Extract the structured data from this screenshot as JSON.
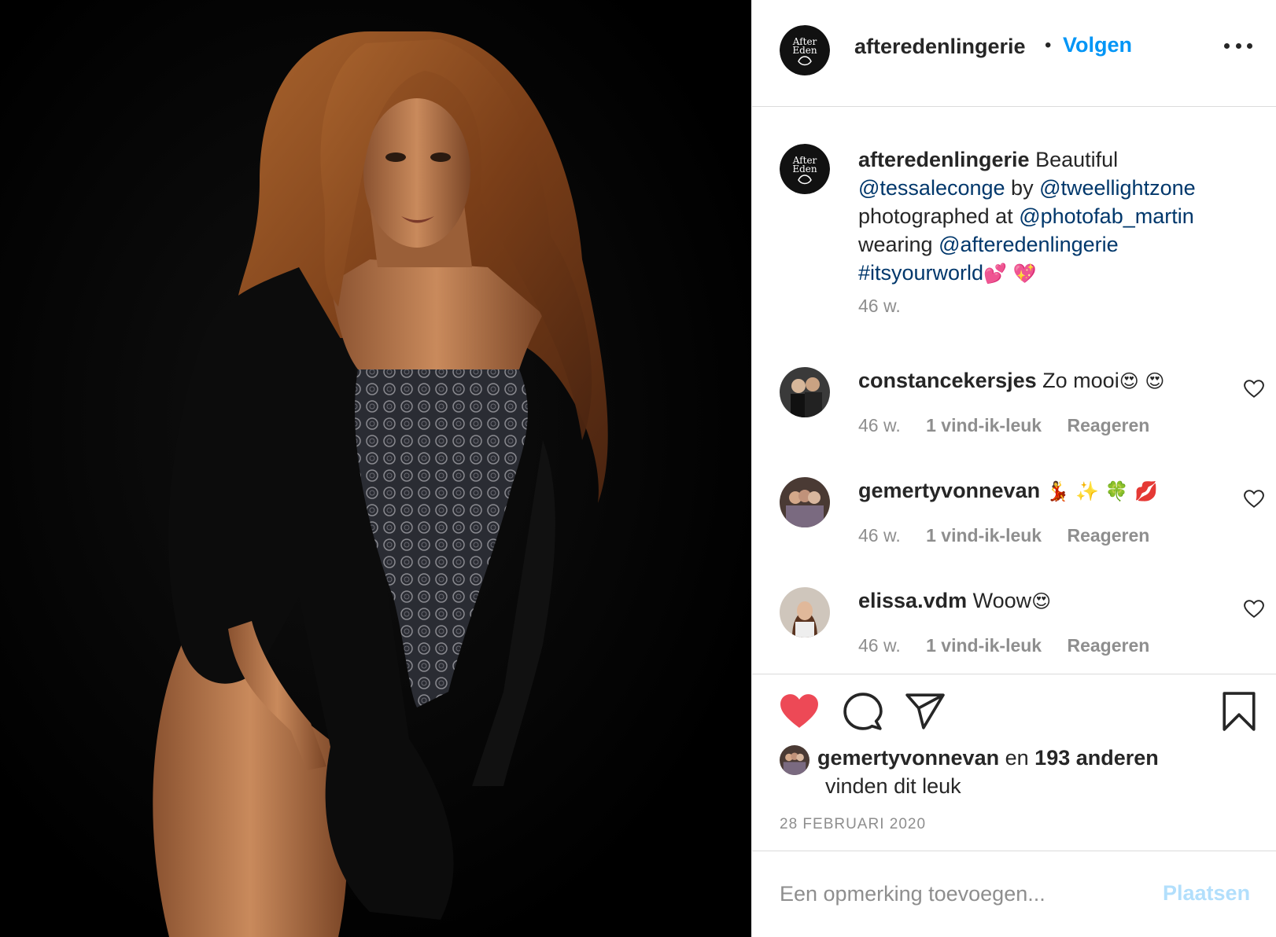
{
  "post": {
    "photo_alt": "",
    "author": {
      "username": "afteredenlingerie",
      "follow_label": "Volgen",
      "separator": "•",
      "avatar_logo_line1": "After",
      "avatar_logo_line2": "Eden"
    },
    "caption": {
      "username": "afteredenlingerie",
      "word1": "Beautiful",
      "mention1": "@tessaleconge",
      "word2": "by",
      "mention2": "@tweellightzone",
      "word3": "photographed at",
      "mention3": "@photofab_martin",
      "word4": "wearing",
      "mention4": "@afteredenlingerie",
      "hashtag": "#itsyourworld",
      "emoji": "💕 💖",
      "time": "46 w."
    },
    "comments": [
      {
        "username": "constancekersjes",
        "text": "Zo mooi",
        "emoji": "😍 😍",
        "time": "46 w.",
        "likes": "1 vind-ik-leuk",
        "reply": "Reageren"
      },
      {
        "username": "gemertyvonnevan",
        "text": "",
        "emoji": "💃 ✨ 🍀 💋",
        "time": "46 w.",
        "likes": "1 vind-ik-leuk",
        "reply": "Reageren"
      },
      {
        "username": "elissa.vdm",
        "text": "Woow",
        "emoji": "😍",
        "time": "46 w.",
        "likes": "1 vind-ik-leuk",
        "reply": "Reageren"
      }
    ],
    "likes": {
      "first_liker": "gemertyvonnevan",
      "connector": "en",
      "others": "193 anderen",
      "suffix": "vinden dit leuk"
    },
    "date": "28 FEBRUARI 2020",
    "add_comment": {
      "placeholder": "Een opmerking toevoegen...",
      "post_label": "Plaatsen"
    },
    "icons": [
      "heart-filled-icon",
      "comment-icon",
      "share-icon",
      "bookmark-icon",
      "more-icon",
      "heart-outline-icon"
    ],
    "colors": {
      "like_red": "#ed4956",
      "follow_blue": "#0095f6",
      "mention_blue": "#00376b",
      "post_disabled": "#b2dffc"
    }
  }
}
